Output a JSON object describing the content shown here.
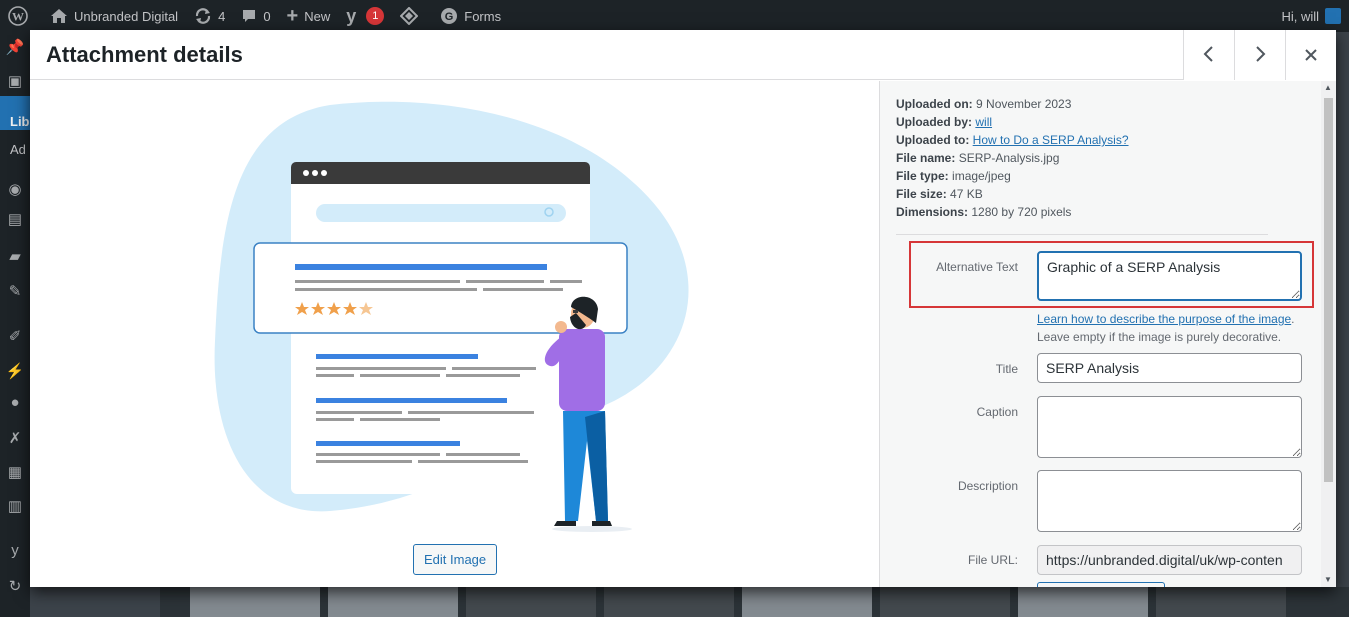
{
  "adminbar": {
    "site_name": "Unbranded Digital",
    "updates_count": "4",
    "comments_count": "0",
    "new_label": "New",
    "yoast_badge": "1",
    "forms_label": "Forms",
    "greeting": "Hi, will"
  },
  "adminmenu": {
    "library_label": "Lib",
    "add_label": "Ad"
  },
  "modal": {
    "title": "Attachment details",
    "prev_icon": "chevron-left-icon",
    "next_icon": "chevron-right-icon",
    "close_icon": "close-icon"
  },
  "preview": {
    "edit_button": "Edit Image"
  },
  "details": {
    "uploaded_on_label": "Uploaded on:",
    "uploaded_on": "9 November 2023",
    "uploaded_by_label": "Uploaded by:",
    "uploaded_by": "will",
    "uploaded_to_label": "Uploaded to:",
    "uploaded_to": "How to Do a SERP Analysis?",
    "file_name_label": "File name:",
    "file_name": "SERP-Analysis.jpg",
    "file_type_label": "File type:",
    "file_type": "image/jpeg",
    "file_size_label": "File size:",
    "file_size": "47 KB",
    "dimensions_label": "Dimensions:",
    "dimensions": "1280 by 720 pixels"
  },
  "fields": {
    "alt_label": "Alternative Text",
    "alt_value": "Graphic of a SERP Analysis",
    "alt_help_link": "Learn how to describe the purpose of the image",
    "alt_help_text": "Leave empty if the image is purely decorative.",
    "title_label": "Title",
    "title_value": "SERP Analysis",
    "caption_label": "Caption",
    "caption_value": "",
    "description_label": "Description",
    "description_value": "",
    "file_url_label": "File URL:",
    "file_url_value": "https://unbranded.digital/uk/wp-conten"
  },
  "colors": {
    "accent": "#2271b1",
    "highlight": "#d63638",
    "admin_bar": "#1d2327"
  }
}
